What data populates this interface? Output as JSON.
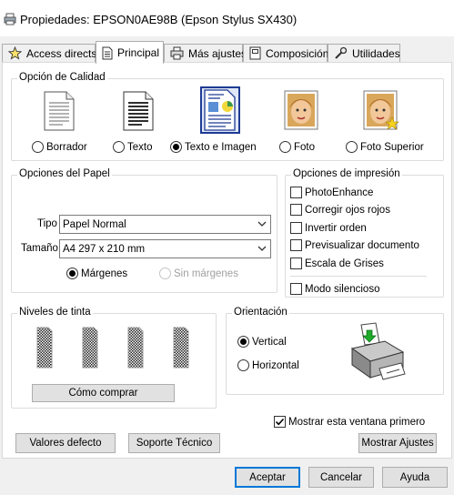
{
  "window": {
    "title": "Propiedades: EPSON0AE98B (Epson Stylus SX430)"
  },
  "tabs": [
    {
      "label": "Access directs",
      "icon": "star-icon"
    },
    {
      "label": "Principal",
      "icon": "page-icon"
    },
    {
      "label": "Más ajustes",
      "icon": "printer-icon"
    },
    {
      "label": "Composición",
      "icon": "layout-icon"
    },
    {
      "label": "Utilidades",
      "icon": "wrench-icon"
    }
  ],
  "active_tab": "Principal",
  "quality": {
    "title": "Opción de Calidad",
    "options": [
      {
        "label": "Borrador",
        "icon": "draft-page-icon",
        "selected": false
      },
      {
        "label": "Texto",
        "icon": "text-page-icon",
        "selected": false
      },
      {
        "label": "Texto e Imagen",
        "icon": "text-image-page-icon",
        "selected": true
      },
      {
        "label": "Foto",
        "icon": "photo-icon",
        "selected": false
      },
      {
        "label": "Foto Superior",
        "icon": "best-photo-icon",
        "selected": false
      }
    ]
  },
  "paper": {
    "title": "Opciones del Papel",
    "type_label": "Tipo",
    "type_value": "Papel Normal",
    "size_label": "Tamaño",
    "size_value": "A4 297 x 210 mm",
    "margins_label": "Márgenes",
    "margins_selected": true,
    "borderless_label": "Sin márgenes",
    "borderless_enabled": false
  },
  "print_options": {
    "title": "Opciones de impresión",
    "items": [
      {
        "label": "PhotoEnhance",
        "checked": false
      },
      {
        "label": "Corregir ojos rojos",
        "checked": false
      },
      {
        "label": "Invertir orden",
        "checked": false
      },
      {
        "label": "Previsualizar documento",
        "checked": false
      },
      {
        "label": "Escala de Grises",
        "checked": false
      }
    ],
    "quiet_label": "Modo silencioso",
    "quiet_checked": false
  },
  "ink": {
    "title": "Niveles de tinta",
    "cartridges": 4,
    "buy_label": "Cómo comprar"
  },
  "orientation": {
    "title": "Orientación",
    "portrait_label": "Vertical",
    "portrait_selected": true,
    "landscape_label": "Horizontal",
    "icon": "printer-portrait-icon"
  },
  "show_window_label": "Mostrar esta ventana primero",
  "show_window_checked": true,
  "buttons": {
    "defaults": "Valores defecto",
    "support": "Soporte Técnico",
    "show_settings": "Mostrar Ajustes",
    "ok": "Aceptar",
    "cancel": "Cancelar",
    "help": "Ayuda"
  },
  "colors": {
    "accent": "#0078d7",
    "border": "#dcdcdc",
    "background": "#f0f0f0"
  }
}
